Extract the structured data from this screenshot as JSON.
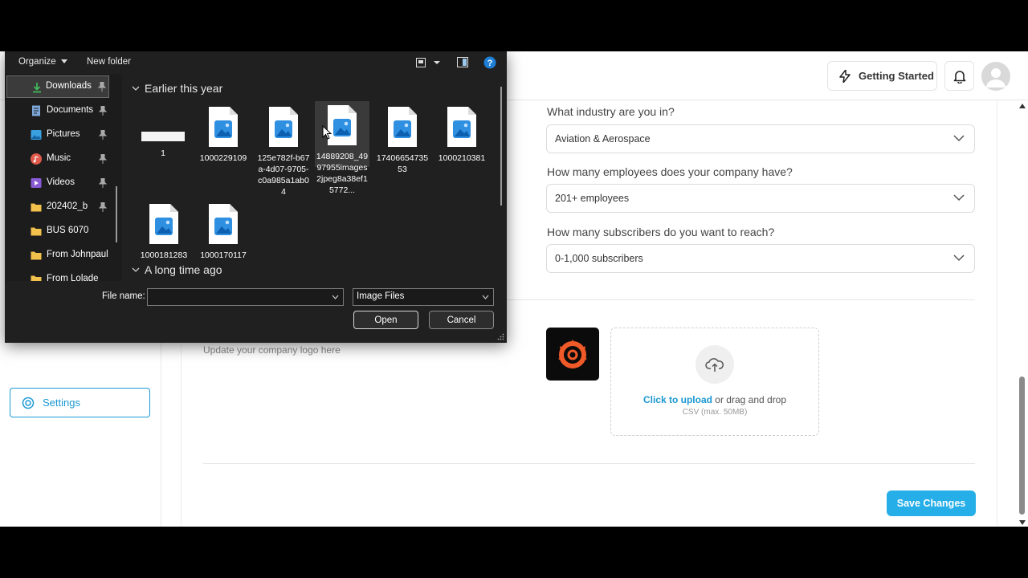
{
  "header": {
    "getting_started_label": "Getting Started"
  },
  "sidebar": {
    "settings_label": "Settings"
  },
  "form": {
    "industry": {
      "question": "What industry are you in?",
      "value": "Aviation & Aerospace"
    },
    "employees": {
      "question": "How many employees does your company have?",
      "value": "201+ employees"
    },
    "subscribers": {
      "question": "How many subscribers do you want to reach?",
      "value": "0-1,000 subscribers"
    },
    "logo_hint": "Update your company logo here",
    "upload": {
      "link": "Click to upload",
      "rest": " or drag and drop",
      "sub": "CSV (max. 50MB)"
    },
    "save_label": "Save Changes"
  },
  "dialog": {
    "toolbar": {
      "organize": "Organize",
      "new_folder": "New folder"
    },
    "nav": [
      {
        "label": "Downloads",
        "icon": "download-icon",
        "color": "#3ec45c"
      },
      {
        "label": "Documents",
        "icon": "documents-icon",
        "color": "#7da7d9"
      },
      {
        "label": "Pictures",
        "icon": "pictures-icon",
        "color": "#3aa0e0"
      },
      {
        "label": "Music",
        "icon": "music-icon",
        "color": "#e05a4b"
      },
      {
        "label": "Videos",
        "icon": "videos-icon",
        "color": "#8a5bd6"
      },
      {
        "label": "202402_b",
        "icon": "folder-icon",
        "color": "#f2c24d"
      },
      {
        "label": "BUS 6070",
        "icon": "folder-icon",
        "color": "#f2c24d"
      },
      {
        "label": "From Johnpaul",
        "icon": "folder-icon",
        "color": "#f2c24d"
      },
      {
        "label": "From Lolade",
        "icon": "folder-icon",
        "color": "#f2c24d"
      }
    ],
    "groups": {
      "earlier": "Earlier this year",
      "long_ago": "A long time ago"
    },
    "files": [
      {
        "name": "1"
      },
      {
        "name": "1000229109"
      },
      {
        "name": "125e782f-b67a-4d07-9705-c0a985a1ab04"
      },
      {
        "name": "14889208_4997955images2jpeg8a38ef15772..."
      },
      {
        "name": "1740665473553"
      },
      {
        "name": "1000210381"
      },
      {
        "name": "1000181283"
      },
      {
        "name": "1000170117"
      }
    ],
    "file_name_label": "File name:",
    "file_name_value": "",
    "file_type": "Image Files",
    "open_label": "Open",
    "cancel_label": "Cancel"
  },
  "colors": {
    "accent": "#1b98d2",
    "save_button": "#25aee8",
    "dialog_bg": "#202020"
  }
}
